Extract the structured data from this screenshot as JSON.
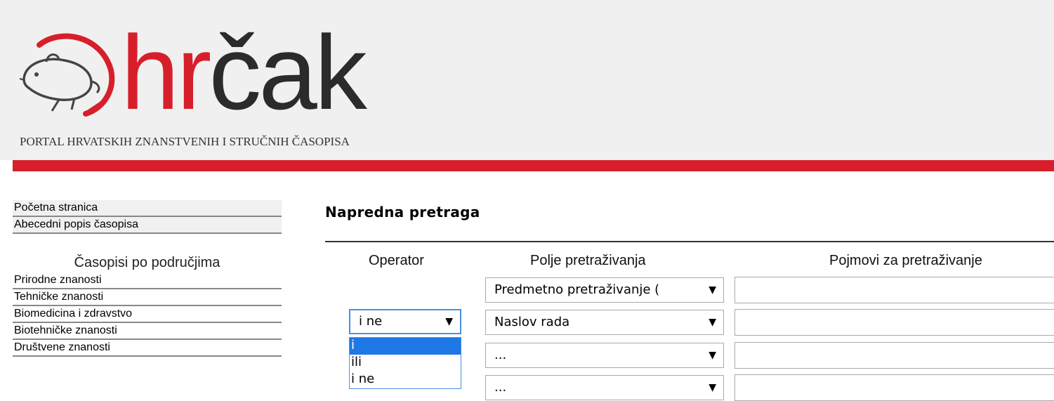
{
  "header": {
    "logo_red": "hr",
    "logo_dark": "čak",
    "tagline": "PORTAL HRVATSKIH ZNANSTVENIH I STRUČNIH ČASOPISA",
    "brand_color": "#d71f2b"
  },
  "sidebar": {
    "links": [
      {
        "label": "Početna stranica"
      },
      {
        "label": "Abecedni popis časopisa"
      }
    ],
    "heading": "Časopisi po područjima",
    "categories": [
      {
        "label": "Prirodne znanosti"
      },
      {
        "label": "Tehničke znanosti"
      },
      {
        "label": "Biomedicina i zdravstvo"
      },
      {
        "label": "Biotehničke znanosti"
      },
      {
        "label": "Društvene znanosti"
      }
    ]
  },
  "main": {
    "title": "Napredna pretraga",
    "columns": {
      "operator": "Operator",
      "field": "Polje pretraživanja",
      "terms": "Pojmovi za pretraživanje"
    },
    "rows": [
      {
        "field": "Predmetno pretraživanje (",
        "term": ""
      },
      {
        "operator": "i ne",
        "field": "Naslov rada",
        "term": ""
      },
      {
        "field": "...",
        "term": ""
      },
      {
        "field": "...",
        "term": ""
      }
    ],
    "operator_dropdown": {
      "options": [
        "i",
        "ili",
        "i ne"
      ],
      "highlighted": "i"
    }
  },
  "icons": {
    "dropdown_arrow": "▼",
    "logo": "hamster-logo-icon"
  }
}
